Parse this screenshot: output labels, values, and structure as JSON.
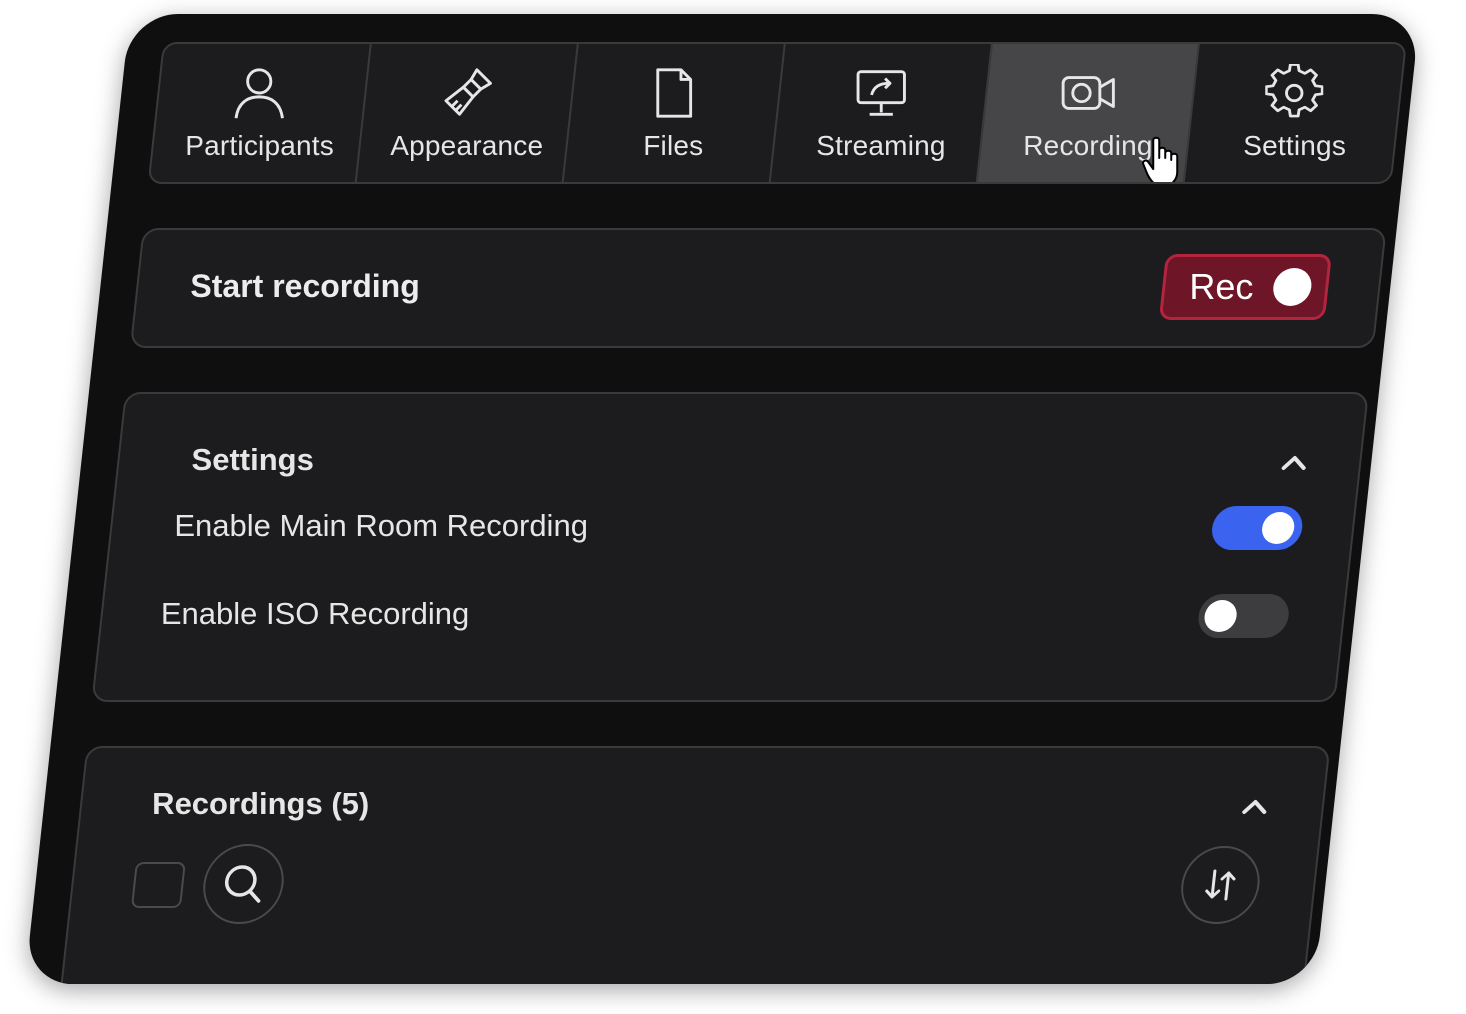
{
  "tabs": [
    {
      "label": "Participants",
      "icon": "user-icon",
      "active": false
    },
    {
      "label": "Appearance",
      "icon": "paintbrush-icon",
      "active": false
    },
    {
      "label": "Files",
      "icon": "file-icon",
      "active": false
    },
    {
      "label": "Streaming",
      "icon": "streaming-monitor-icon",
      "active": false
    },
    {
      "label": "Recording",
      "icon": "video-camera-icon",
      "active": true
    },
    {
      "label": "Settings",
      "icon": "gear-icon",
      "active": false
    }
  ],
  "start_recording": {
    "title": "Start recording",
    "button_label": "Rec",
    "button_color": "#6e1628"
  },
  "settings_section": {
    "title": "Settings",
    "items": [
      {
        "label": "Enable Main Room Recording",
        "enabled": true
      },
      {
        "label": "Enable ISO Recording",
        "enabled": false
      }
    ],
    "toggle_on_color": "#3a63f0"
  },
  "recordings_section": {
    "title": "Recordings (5)"
  }
}
